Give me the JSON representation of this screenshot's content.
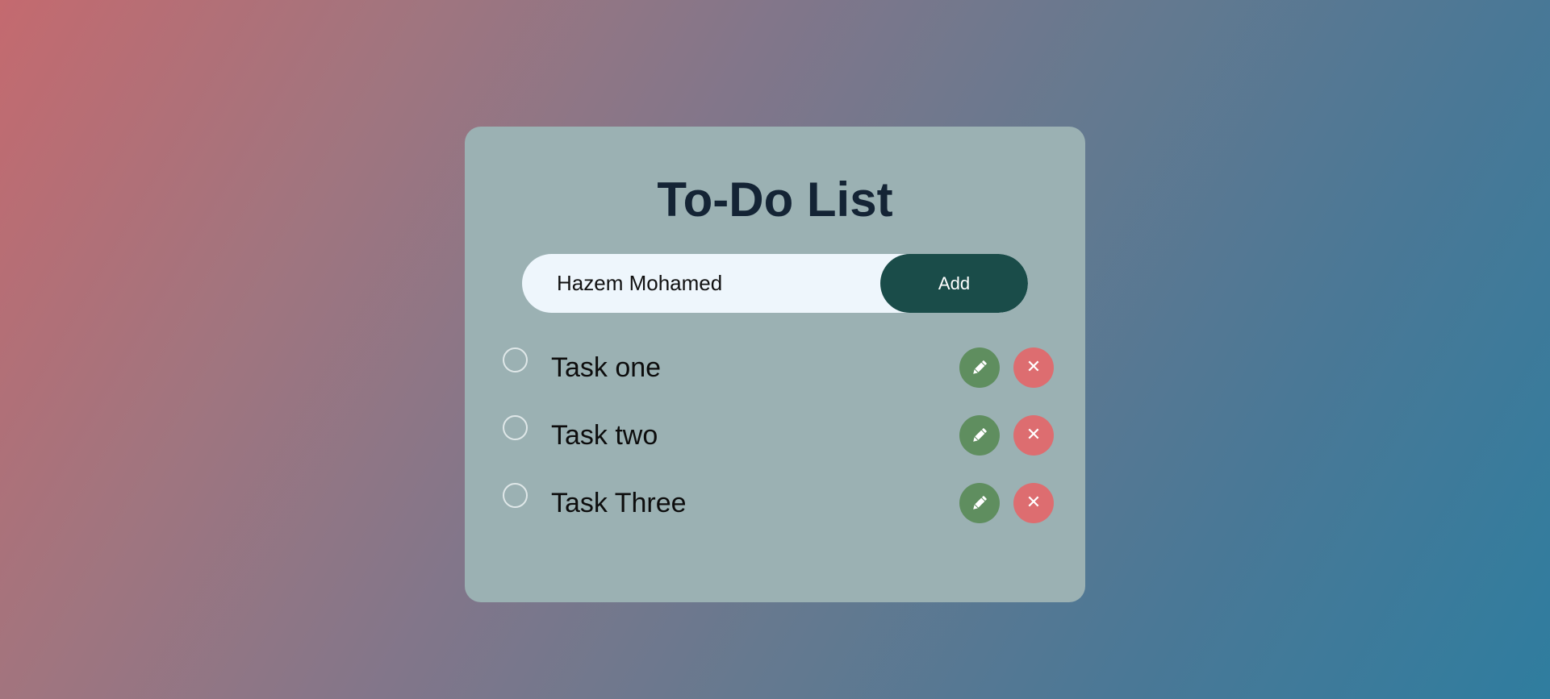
{
  "app": {
    "title": "To-Do List"
  },
  "form": {
    "input_value": "Hazem Mohamed",
    "add_label": "Add"
  },
  "tasks": [
    {
      "text": "Task one",
      "completed": false
    },
    {
      "text": "Task two",
      "completed": false
    },
    {
      "text": "Task Three",
      "completed": false
    }
  ],
  "icons": {
    "checkbox": "circle-outline-icon",
    "edit": "pencil-icon",
    "delete": "x-icon"
  },
  "colors": {
    "background_start": "#c46a6f",
    "background_end": "#2f7d9f",
    "card": "#9bb1b3",
    "title": "#142435",
    "add_button": "#1a4c49",
    "edit_button": "#5f8e5f",
    "delete_button": "#dd6d70"
  }
}
